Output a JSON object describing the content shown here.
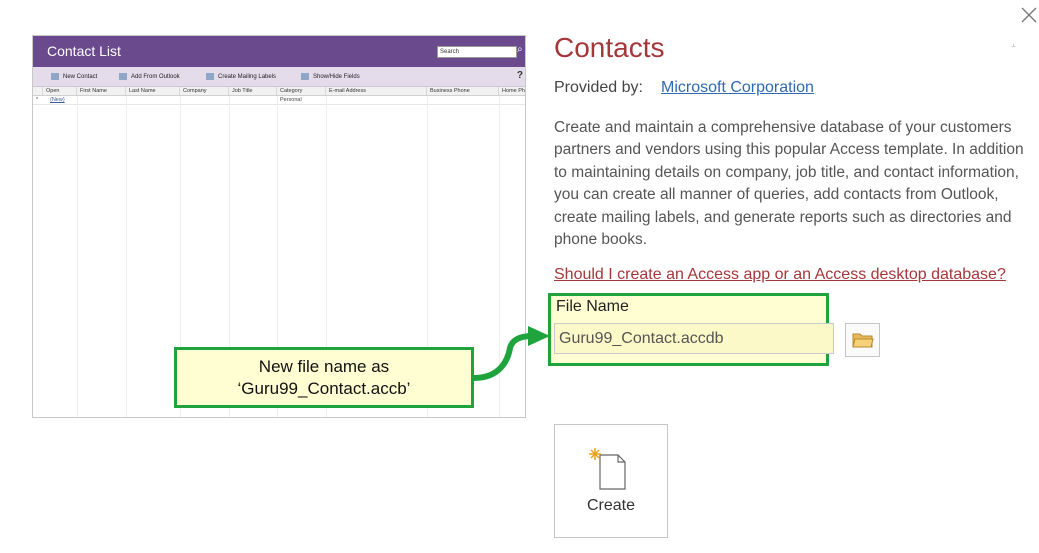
{
  "preview": {
    "title": "Contact List",
    "search_placeholder": "Search",
    "toolbar": {
      "new_contact": "New Contact",
      "add_from_outlook": "Add From Outlook",
      "create_mailing_labels": "Create Mailing Labels",
      "show_hide_fields": "Show/Hide Fields"
    },
    "columns": [
      "Open",
      "First Name",
      "Last Name",
      "Company",
      "Job Title",
      "Category",
      "E-mail Address",
      "Business Phone",
      "Home Ph"
    ],
    "row": {
      "marker": "*",
      "open": "(New)",
      "category": "Personal"
    }
  },
  "callout": {
    "line1": "New file name as",
    "line2": "‘Guru99_Contact.accb’"
  },
  "template": {
    "title": "Contacts",
    "provided_by_label": "Provided by:",
    "provider": "Microsoft Corporation",
    "description": "Create and maintain a comprehensive database of your customers partners and vendors using this popular Access template. In addition to maintaining details on company, job title, and contact information, you can create all manner of queries, add contacts from Outlook, create mailing labels, and generate reports such as directories and phone books.",
    "question_link": "Should I create an Access app or an Access desktop database?",
    "file_name_label": "File Name",
    "file_name_value": "Guru99_Contact.accdb",
    "create_label": "Create"
  },
  "colors": {
    "accent": "#a4373a",
    "link": "#2e6ab1",
    "highlight_border": "#1fa33c",
    "highlight_fill": "#fffed3",
    "preview_titlebar": "#6a4a8c"
  },
  "icons": [
    "close-icon",
    "pin-icon",
    "folder-icon",
    "new-document-icon",
    "search-icon"
  ]
}
